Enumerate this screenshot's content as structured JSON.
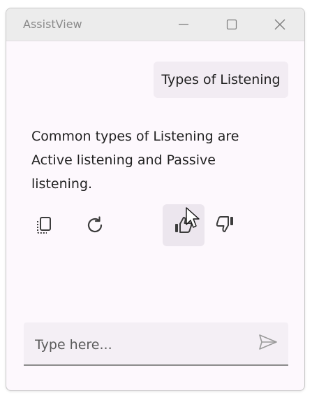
{
  "window": {
    "title": "AssistView"
  },
  "titlebar": {
    "minimize_icon": "minimize-icon",
    "maximize_icon": "maximize-icon",
    "close_icon": "close-icon"
  },
  "conversation": {
    "user_message": "Types of Listening",
    "assistant_response": "Common types of Listening are Active listening and Passive listening."
  },
  "response_actions": [
    {
      "name": "copy",
      "icon": "copy-icon"
    },
    {
      "name": "regenerate",
      "icon": "refresh-icon"
    },
    {
      "name": "like",
      "icon": "thumbs-up-icon",
      "hovered": true
    },
    {
      "name": "dislike",
      "icon": "thumbs-down-icon"
    }
  ],
  "composer": {
    "placeholder": "Type here...",
    "value": "",
    "send_icon": "send-icon"
  },
  "colors": {
    "window_bg": "#fdf8fd",
    "titlebar_bg": "#ececec",
    "bubble_bg": "#f2ecf3",
    "input_bg": "#f4eff5",
    "hover_bg": "#ece6ee",
    "icon_color": "#3c3c3c"
  }
}
